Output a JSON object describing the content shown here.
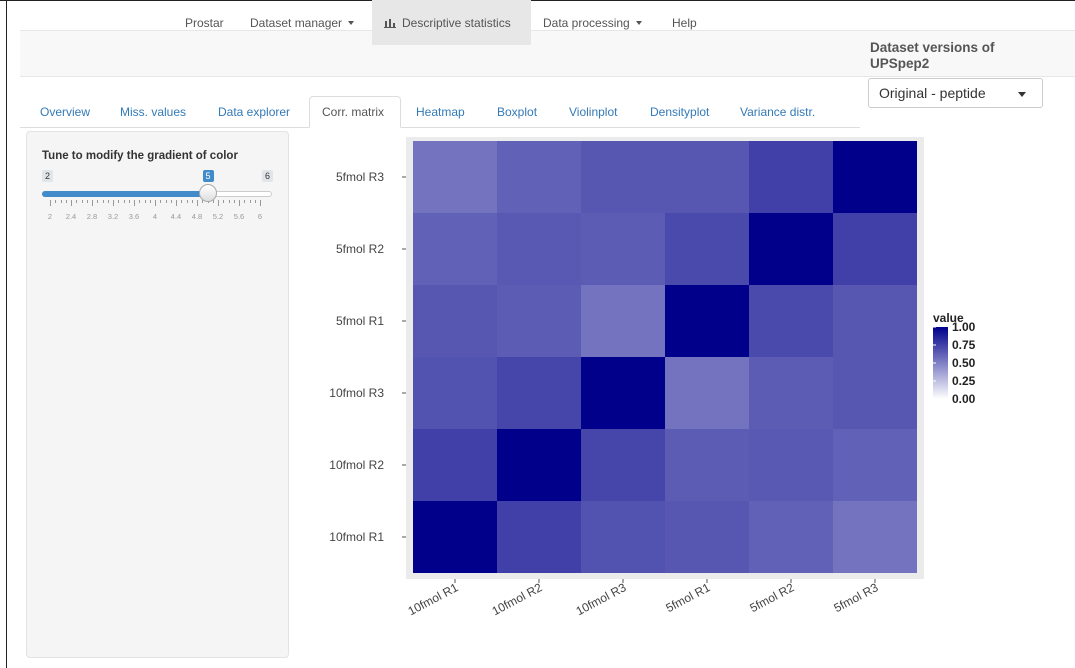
{
  "navbar": {
    "brand": "Prostar",
    "items": [
      {
        "label": "Dataset manager",
        "dropdown": true
      },
      {
        "label": "Descriptive statistics",
        "active": true,
        "icon": "bar-chart-icon"
      },
      {
        "label": "Data processing",
        "dropdown": true
      },
      {
        "label": "Help"
      }
    ]
  },
  "dataset_versions": {
    "title": "Dataset versions of UPSpep2",
    "selected": "Original - peptide"
  },
  "tabs": [
    {
      "label": "Overview"
    },
    {
      "label": "Miss. values"
    },
    {
      "label": "Data explorer"
    },
    {
      "label": "Corr. matrix",
      "active": true
    },
    {
      "label": "Heatmap"
    },
    {
      "label": "Boxplot"
    },
    {
      "label": "Violinplot"
    },
    {
      "label": "Densityplot"
    },
    {
      "label": "Variance distr."
    }
  ],
  "sidebar": {
    "slider_label": "Tune to modify the gradient of color",
    "slider": {
      "min": 2,
      "max": 6,
      "value": 5,
      "min_label": "2",
      "max_label": "6",
      "value_label": "5",
      "ticks": [
        "2",
        "2.4",
        "2.8",
        "3.2",
        "3.6",
        "4",
        "4.4",
        "4.8",
        "5.2",
        "5.6",
        "6"
      ]
    }
  },
  "chart_data": {
    "type": "heatmap",
    "rows": [
      "10fmol R1",
      "10fmol R2",
      "10fmol R3",
      "5fmol R1",
      "5fmol R2",
      "5fmol R3"
    ],
    "columns": [
      "10fmol R1",
      "10fmol R2",
      "10fmol R3",
      "5fmol R1",
      "5fmol R2",
      "5fmol R3"
    ],
    "values": [
      [
        1.0,
        0.75,
        0.68,
        0.66,
        0.62,
        0.55
      ],
      [
        0.75,
        1.0,
        0.73,
        0.64,
        0.65,
        0.62
      ],
      [
        0.68,
        0.73,
        1.0,
        0.55,
        0.64,
        0.66
      ],
      [
        0.66,
        0.64,
        0.55,
        1.0,
        0.71,
        0.66
      ],
      [
        0.62,
        0.65,
        0.64,
        0.71,
        1.0,
        0.75
      ],
      [
        0.55,
        0.62,
        0.66,
        0.66,
        0.75,
        1.0
      ]
    ],
    "legend": {
      "title": "value",
      "ticks": [
        "1.00",
        "0.75",
        "0.50",
        "0.25",
        "0.00"
      ],
      "placement": "right"
    },
    "colors": {
      "low": "#ffffff",
      "high": "#00008b",
      "panel": "#ebebeb"
    }
  }
}
